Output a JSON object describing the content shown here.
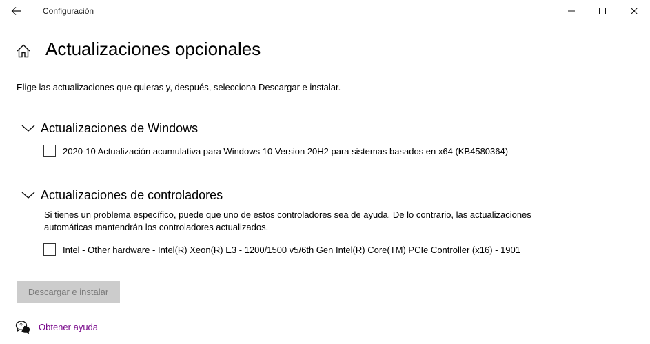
{
  "window": {
    "title": "Configuración",
    "controls": {
      "minimize_icon": "minimize-icon",
      "maximize_icon": "maximize-icon",
      "close_icon": "close-icon"
    }
  },
  "page": {
    "title": "Actualizaciones opcionales",
    "intro": "Elige las actualizaciones que quieras y, después, selecciona Descargar e instalar."
  },
  "sections": {
    "windows": {
      "title": "Actualizaciones de Windows",
      "expanded": true,
      "items": [
        {
          "label": "2020-10 Actualización acumulativa para Windows 10 Version 20H2 para sistemas basados en x64 (KB4580364)",
          "checked": false
        }
      ]
    },
    "drivers": {
      "title": "Actualizaciones de controladores",
      "expanded": true,
      "description": "Si tienes un problema específico, puede que uno de estos controladores sea de ayuda. De lo contrario, las actualizaciones automáticas mantendrán los controladores actualizados.",
      "items": [
        {
          "label": "Intel - Other hardware - Intel(R) Xeon(R) E3 - 1200/1500 v5/6th Gen Intel(R) Core(TM) PCIe Controller (x16) - 1901",
          "checked": false
        }
      ]
    }
  },
  "actions": {
    "download_label": "Descargar e instalar",
    "download_enabled": false
  },
  "help": {
    "label": "Obtener ayuda"
  },
  "colors": {
    "link": "#7a0a8c",
    "button_disabled_bg": "#cccccc",
    "button_disabled_text": "#7a7a7a"
  }
}
